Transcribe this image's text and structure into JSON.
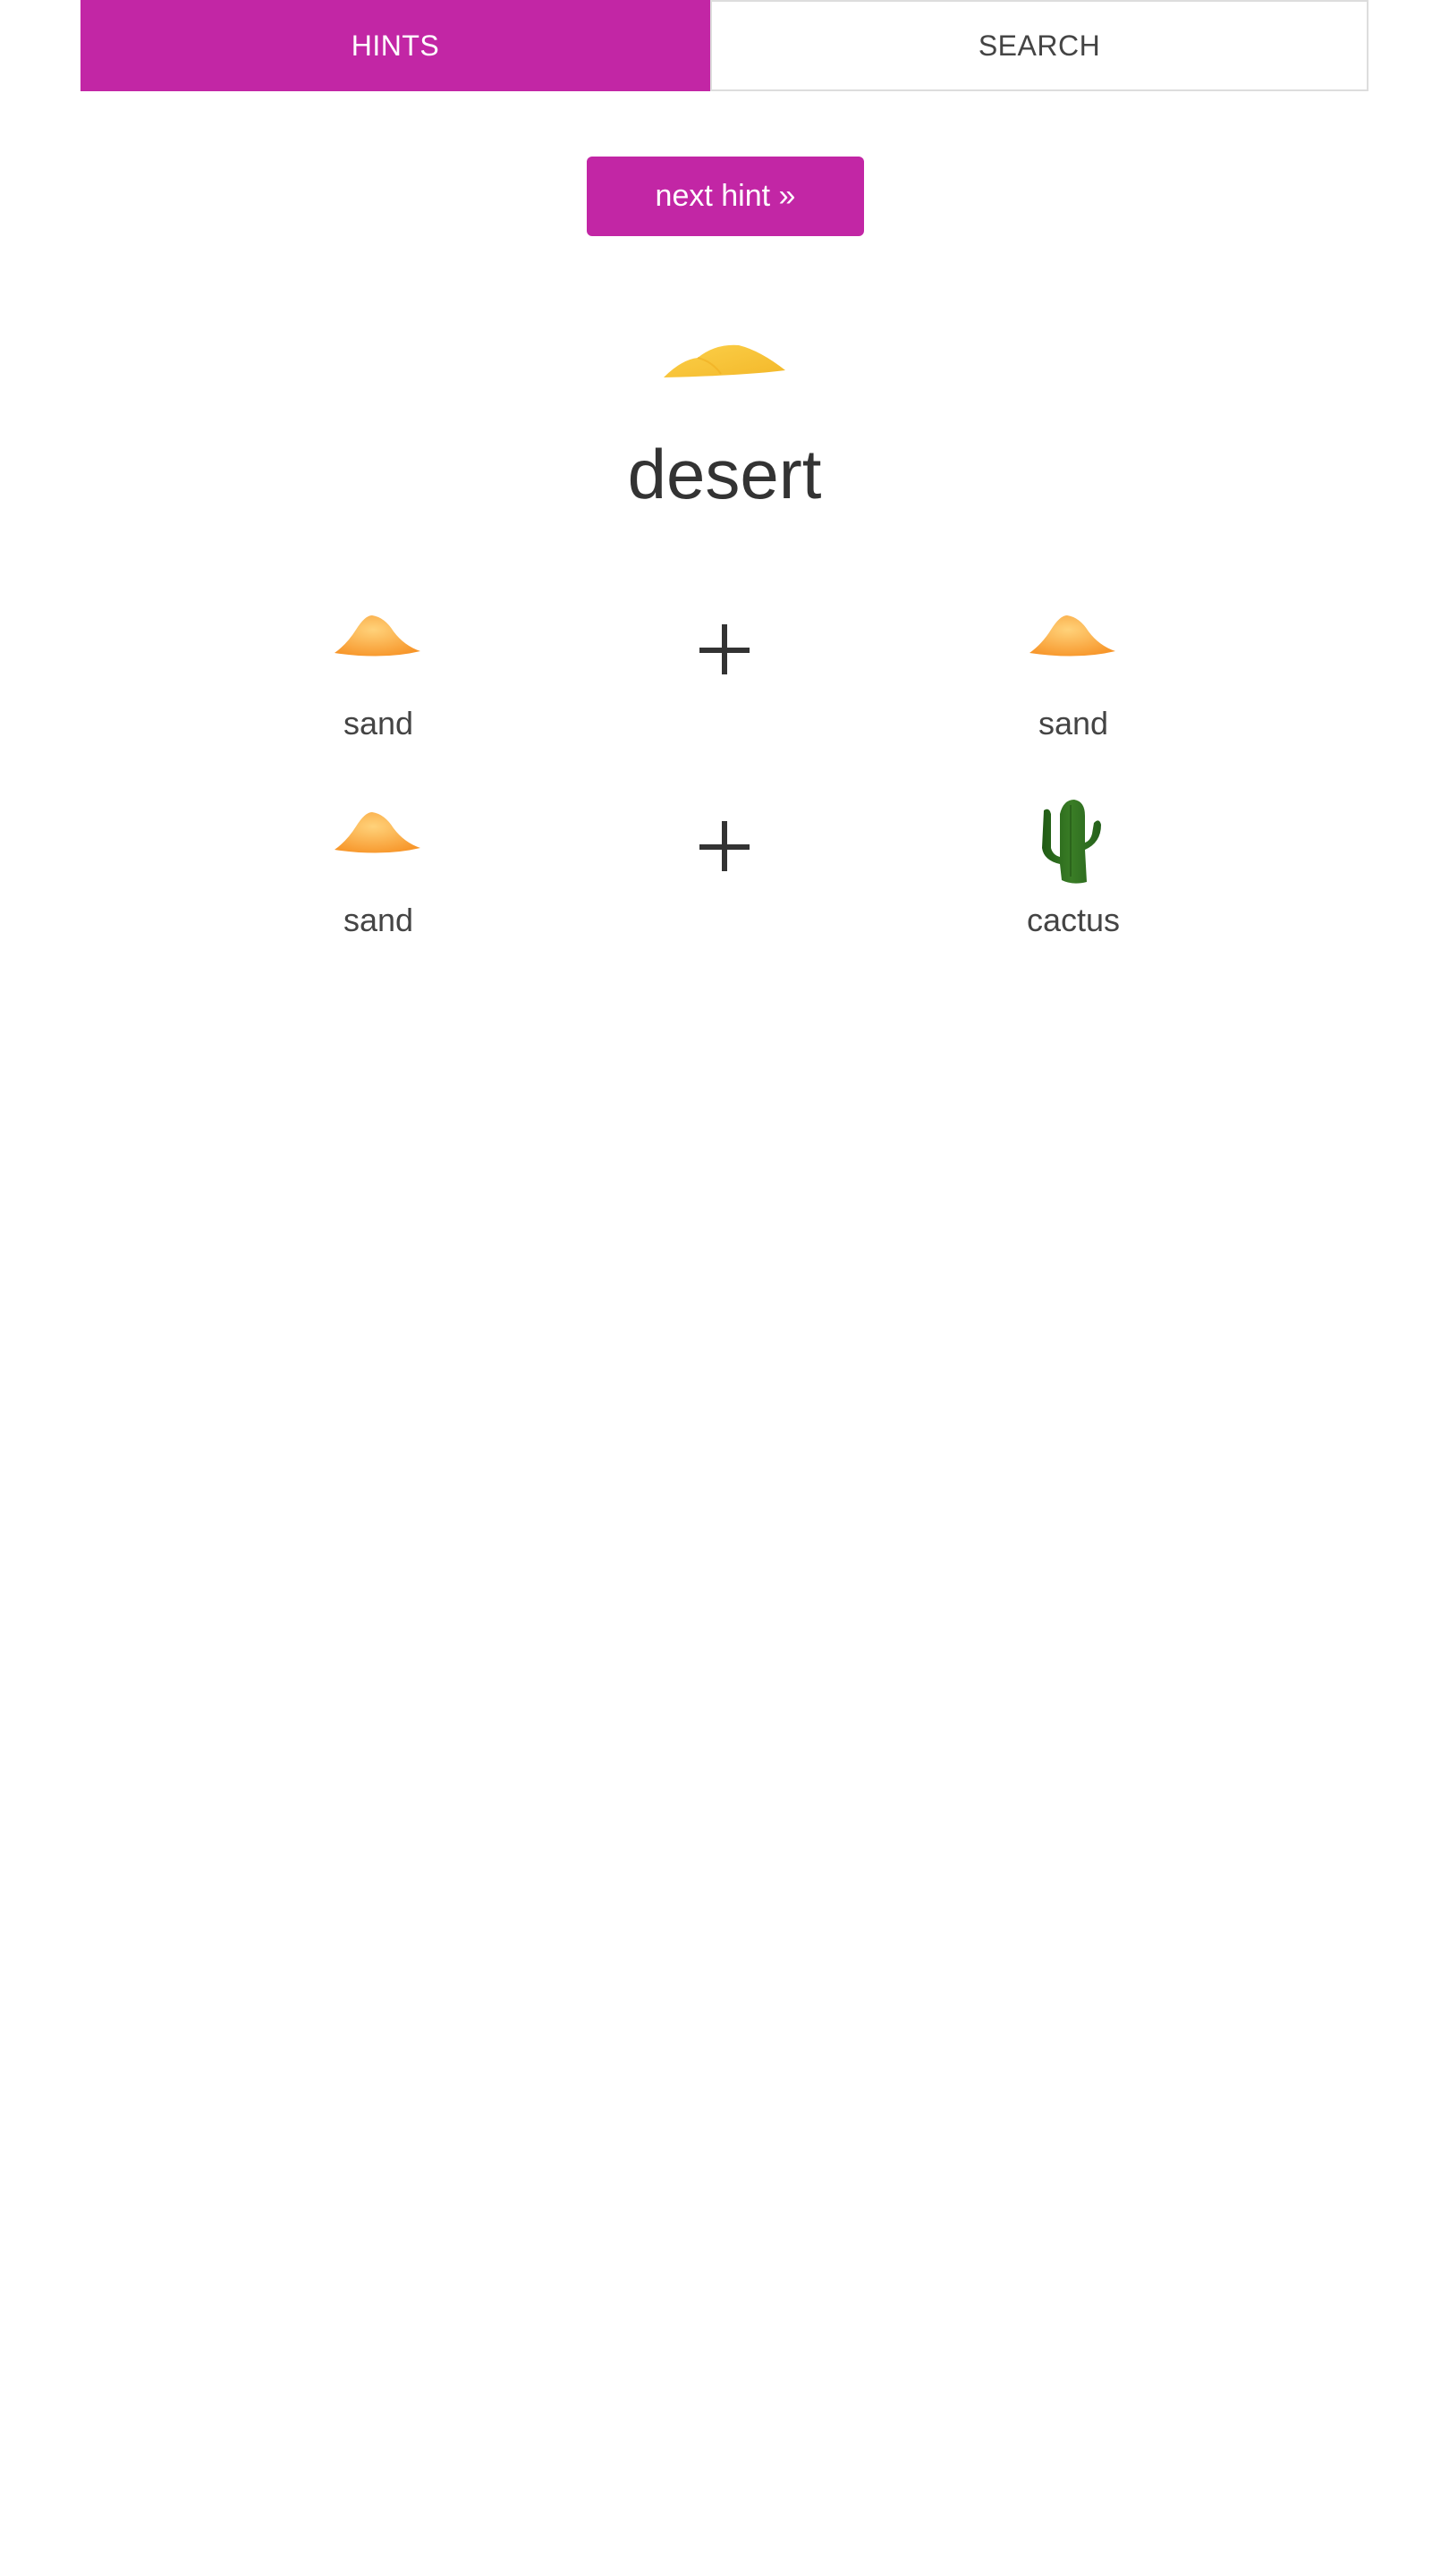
{
  "tabs": [
    {
      "label": "HINTS",
      "active": true
    },
    {
      "label": "SEARCH",
      "active": false
    }
  ],
  "next_button": {
    "label": "next hint »"
  },
  "target": {
    "name": "desert",
    "icon": "desert-dunes-icon"
  },
  "recipes": [
    {
      "left": {
        "name": "sand",
        "icon": "sand-pile-icon"
      },
      "operator": "+",
      "right": {
        "name": "sand",
        "icon": "sand-pile-icon"
      }
    },
    {
      "left": {
        "name": "sand",
        "icon": "sand-pile-icon"
      },
      "operator": "+",
      "right": {
        "name": "cactus",
        "icon": "cactus-icon"
      }
    }
  ],
  "colors": {
    "accent": "#c226a5",
    "text": "#333333",
    "sand": "#f9a93b",
    "dune": "#f7c139",
    "cactus": "#2f6b1e"
  }
}
